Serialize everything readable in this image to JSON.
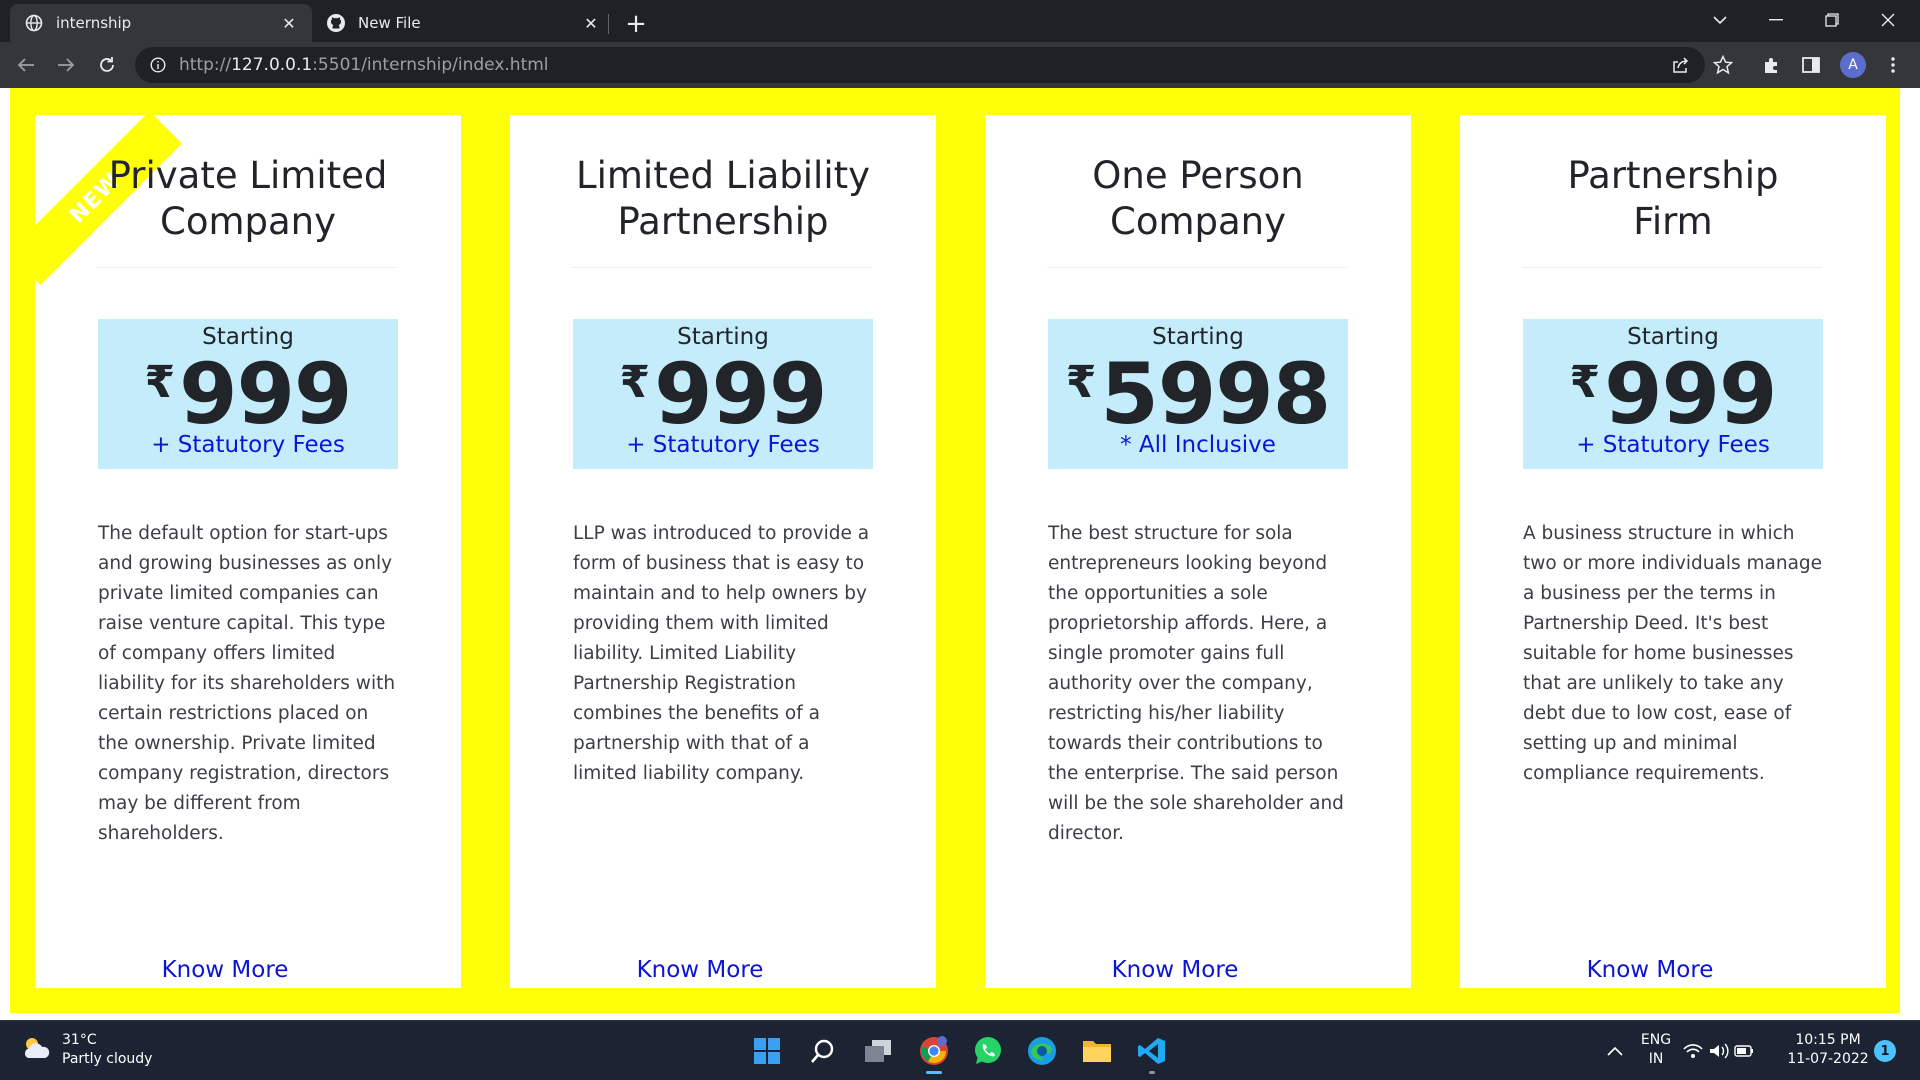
{
  "browser": {
    "tabs": [
      {
        "title": "internship",
        "icon": "globe-icon",
        "active": true
      },
      {
        "title": "New File",
        "icon": "github-icon",
        "active": false
      }
    ],
    "url_scheme": "http://",
    "url_host": "127.0.0.1",
    "url_path": ":5501/internship/index.html",
    "profile_initial": "A"
  },
  "cards": [
    {
      "title_line1": "Private Limited",
      "title_line2": "Company",
      "starting": "Starting",
      "currency": "₹",
      "price": "999",
      "fees": "+ Statutory Fees",
      "description": "The default option for start-ups and growing businesses as only private limited companies can raise venture capital. This type of company offers limited liability for its shareholders with certain restrictions placed on the ownership. Private limited company registration, directors may be different from shareholders.",
      "cta": "Know More",
      "badge": "NEW"
    },
    {
      "title_line1": "Limited Liability",
      "title_line2": "Partnership",
      "starting": "Starting",
      "currency": "₹",
      "price": "999",
      "fees": "+ Statutory Fees",
      "description": "LLP was introduced to provide a form of business that is easy to maintain and to help owners by providing them with limited liability. Limited Liability Partnership Registration combines the benefits of a partnership with that of a limited liability company.",
      "cta": "Know More"
    },
    {
      "title_line1": "One Person",
      "title_line2": "Company",
      "starting": "Starting",
      "currency": "₹",
      "price": "5998",
      "fees": "* All Inclusive",
      "description": "The best structure for sola entrepreneurs looking beyond the opportunities a sole proprietorship affords. Here, a single promoter gains full authority over the company, restricting his/her liability towards their contributions to the enterprise. The said person will be the sole shareholder and director.",
      "cta": "Know More"
    },
    {
      "title_line1": "Partnership",
      "title_line2": "Firm",
      "starting": "Starting",
      "currency": "₹",
      "price": "999",
      "fees": "+ Statutory Fees",
      "description": "A business structure in which two or more individuals manage a business per the terms in Partnership Deed. It's best suitable for home businesses that are unlikely to take any debt due to low cost, ease of setting up and minimal compliance requirements.",
      "cta": "Know More"
    }
  ],
  "taskbar": {
    "temperature": "31°C",
    "weather": "Partly cloudy",
    "lang_top": "ENG",
    "lang_bottom": "IN",
    "time": "10:15 PM",
    "date": "11-07-2022",
    "notification_count": "1"
  },
  "colors": {
    "frame": "#ffff07",
    "price_box": "#c4ecfb",
    "link": "#0d14d4"
  }
}
